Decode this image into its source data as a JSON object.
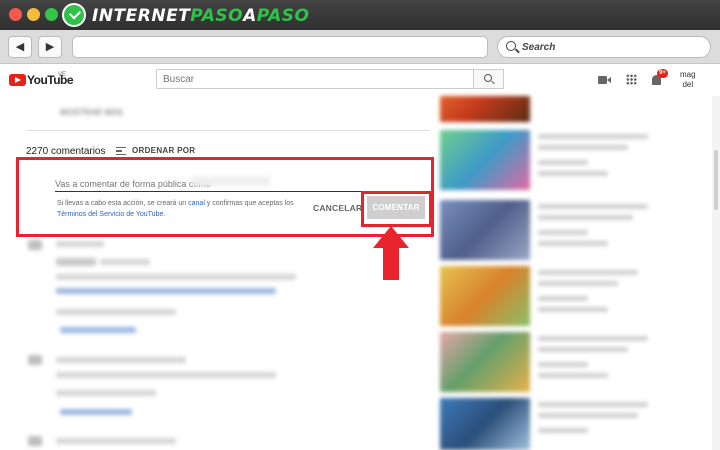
{
  "site_brand": {
    "part1": "INTERNET",
    "part2": "PASO",
    "part3": "A",
    "part4": "PASO"
  },
  "browser": {
    "back_label": "◀",
    "forward_label": "▶",
    "search_label": "Search"
  },
  "youtube": {
    "wordmark": "YouTube",
    "country": "VE",
    "search_placeholder": "Buscar",
    "notifications_badge": "9+",
    "account_line1": "mag",
    "account_line2": "del"
  },
  "comments": {
    "show_more": "MOSTRAR MÁS",
    "count_label": "2270 comentarios",
    "sort_label": "ORDENAR POR",
    "input_placeholder": "Vas a comentar de forma pública como",
    "terms_part1": "Si llevas a cabo esta acción, se creará un ",
    "terms_link1": "canal",
    "terms_part2": " y confirmas que aceptas los",
    "terms_link2": "Términos del Servicio de YouTube",
    "terms_part3": ".",
    "cancel_label": "CANCELAR",
    "submit_label": "COMENTAR"
  },
  "colors": {
    "highlight": "#e8232e",
    "youtube_red": "#e62117",
    "link_blue": "#2a64c6",
    "brand_green": "#2ec24a"
  }
}
